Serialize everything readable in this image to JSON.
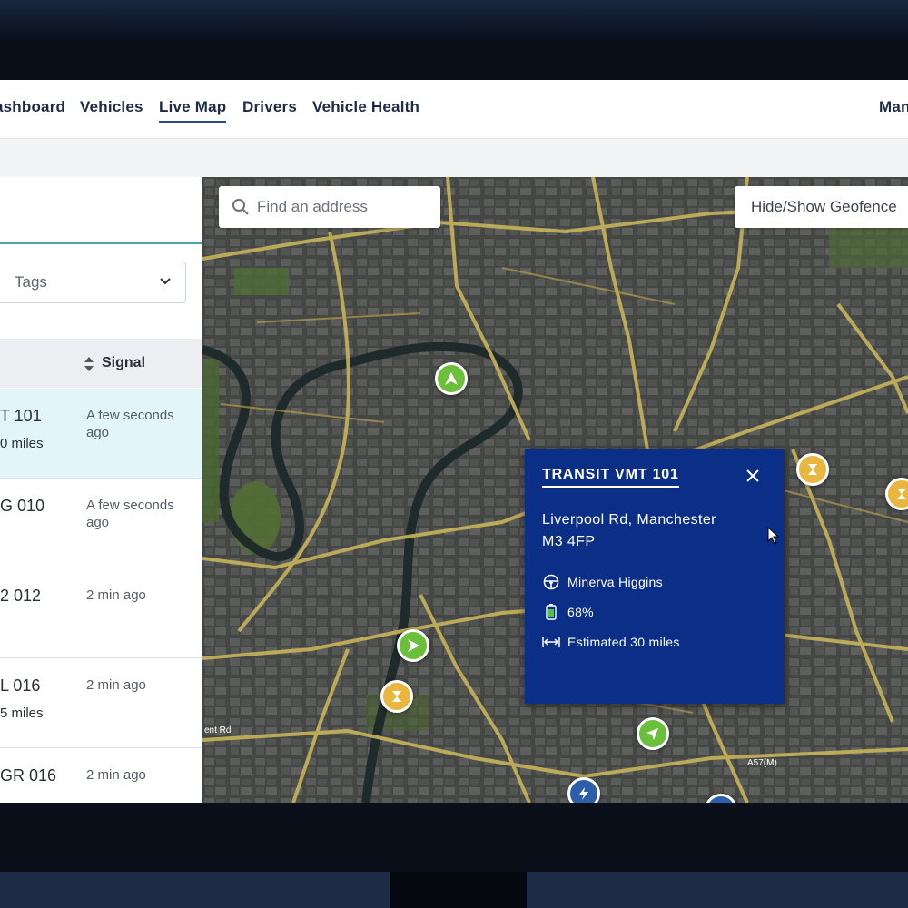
{
  "nav": {
    "items": [
      {
        "label": "ashboard",
        "name": "nav-dashboard"
      },
      {
        "label": "Vehicles",
        "name": "nav-vehicles"
      },
      {
        "label": "Live Map",
        "name": "nav-live-map"
      },
      {
        "label": "Drivers",
        "name": "nav-drivers"
      },
      {
        "label": "Vehicle Health",
        "name": "nav-vehicle-health"
      }
    ],
    "right_label": "Man",
    "active": "Live Map"
  },
  "sidebar": {
    "tags_select": {
      "value": "Tags"
    },
    "table": {
      "signal_header": "Signal",
      "rows": [
        {
          "vehicle": "T 101",
          "detail": "0 miles",
          "signal": "A few seconds ago",
          "selected": true
        },
        {
          "vehicle": "G 010",
          "detail": "",
          "signal": "A few seconds ago",
          "selected": false
        },
        {
          "vehicle": "2 012",
          "detail": "",
          "signal": "2 min ago",
          "selected": false
        },
        {
          "vehicle": "L 016",
          "detail": "5 miles",
          "signal": "2 min ago",
          "selected": false
        },
        {
          "vehicle": "GR 016",
          "detail": "",
          "signal": "2 min ago",
          "selected": false
        }
      ]
    }
  },
  "map": {
    "search": {
      "placeholder": "Find an address",
      "icon": "search-icon"
    },
    "geofence_button": "Hide/Show Geofence",
    "road_labels": [
      "A57(M)",
      "ent Rd"
    ],
    "markers": [
      {
        "type": "moving",
        "icon": "arrow-icon",
        "color": "#6cbf3b"
      },
      {
        "type": "moving",
        "icon": "arrow-icon",
        "color": "#6cbf3b"
      },
      {
        "type": "moving",
        "icon": "arrow-icon",
        "color": "#6cbf3b"
      },
      {
        "type": "idle",
        "icon": "hourglass-icon",
        "color": "#e9b640"
      },
      {
        "type": "idle",
        "icon": "hourglass-icon",
        "color": "#e9b640"
      },
      {
        "type": "idle",
        "icon": "hourglass-icon",
        "color": "#e9b640"
      },
      {
        "type": "charging",
        "icon": "lightning-icon",
        "color": "#2c5fa8"
      },
      {
        "type": "charging",
        "icon": "lightning-icon",
        "color": "#2c5fa8"
      }
    ],
    "popup": {
      "title": "TRANSIT VMT 101",
      "address_line1": "Liverpool Rd, Manchester",
      "address_line2": "M3 4FP",
      "driver": "Minerva Higgins",
      "battery": "68%",
      "range": "Estimated 30 miles",
      "background": "#0b2f86"
    }
  }
}
